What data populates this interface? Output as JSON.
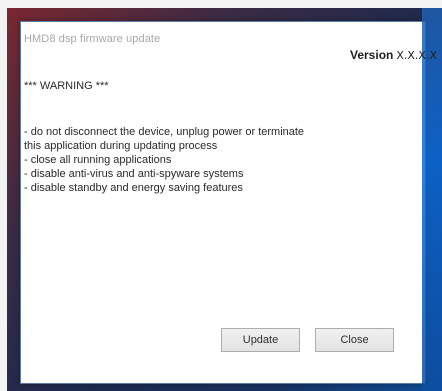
{
  "dialog": {
    "title": "HMD8 dsp firmware update",
    "version_label": "Version",
    "version_value": "X.X.X.X",
    "warning": "*** WARNING ***",
    "notes": [
      "- do not disconnect the device, unplug power or terminate",
      "this application during updating process",
      "- close all running applications",
      "- disable anti-virus and anti-spyware systems",
      "- disable standby and energy saving features"
    ],
    "buttons": {
      "update": "Update",
      "close": "Close"
    }
  }
}
